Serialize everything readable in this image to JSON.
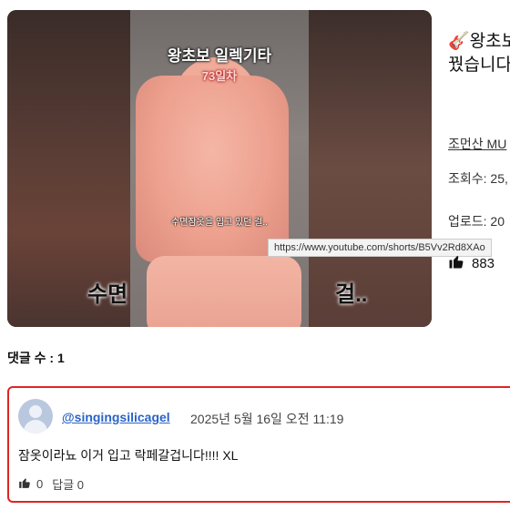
{
  "video": {
    "overlay_title": "왕초보 일렉기타",
    "overlay_day": "73일차",
    "overlay_caption_small": "수면잠옷을 입고 있던 걸..",
    "overlay_caption_big_left": "수면",
    "overlay_caption_big_right": "걸..",
    "url_tooltip": "https://www.youtube.com/shorts/B5Vv2Rd8XAo"
  },
  "info": {
    "title_line1": "🎸왕초보",
    "title_line2": "꿨습니다",
    "channel": "조먼산 MU",
    "views": "조회수: 25,",
    "upload": "업로드: 20",
    "likes": "883"
  },
  "comments": {
    "count_label": "댓글 수 : 1",
    "items": [
      {
        "username": "@singingsilicagel",
        "date": "2025년 5월 16일 오전 11:19",
        "text": "잠옷이라뇨 이거 입고 락페갈겁니다!!!! XL",
        "likes": "0",
        "replies": "답글 0"
      }
    ]
  },
  "icons": {
    "like": "thumbs-up-icon",
    "avatar": "user-avatar-icon"
  }
}
